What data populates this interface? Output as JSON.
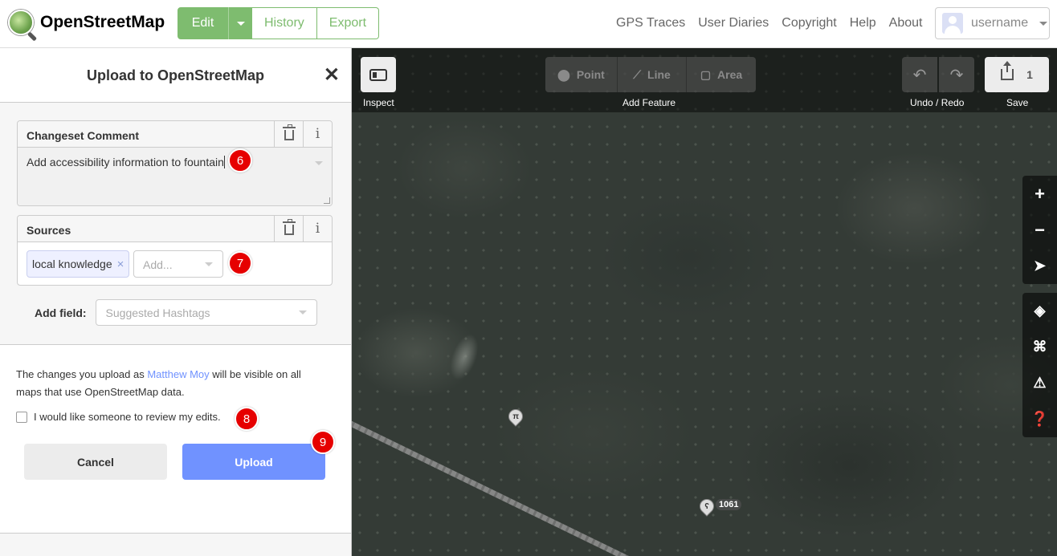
{
  "header": {
    "logo_text": "OpenStreetMap",
    "edit_label": "Edit",
    "history_label": "History",
    "export_label": "Export",
    "nav": [
      "GPS Traces",
      "User Diaries",
      "Copyright",
      "Help",
      "About"
    ],
    "username": "username",
    "colors": {
      "brand_green": "#7ebc6f"
    }
  },
  "sidebar": {
    "title": "Upload to OpenStreetMap",
    "changeset_comment": {
      "label": "Changeset Comment",
      "value": "Add accessibility information to fountain"
    },
    "sources": {
      "label": "Sources",
      "chips": [
        "local knowledge"
      ],
      "add_placeholder": "Add..."
    },
    "add_field": {
      "label": "Add field:",
      "placeholder": "Suggested Hashtags"
    },
    "notice": {
      "before": "The changes you upload as ",
      "user_link": "Matthew Moy",
      "after": " will be visible on all maps that use OpenStreetMap data."
    },
    "review_checkbox_label": "I would like someone to review my edits.",
    "review_checked": false,
    "cancel_label": "Cancel",
    "upload_label": "Upload",
    "colors": {
      "upload_blue": "#7092ff"
    }
  },
  "step_markers": [
    "6",
    "7",
    "8",
    "9"
  ],
  "map": {
    "toolbar": {
      "inspect_label": "Inspect",
      "add_feature_label": "Add Feature",
      "features": [
        "Point",
        "Line",
        "Area"
      ],
      "undo_redo_label": "Undo / Redo",
      "save_label": "Save",
      "save_count": "1"
    },
    "controls": {
      "zoom_in": "+",
      "zoom_out": "−"
    },
    "poi_label": "1061"
  }
}
